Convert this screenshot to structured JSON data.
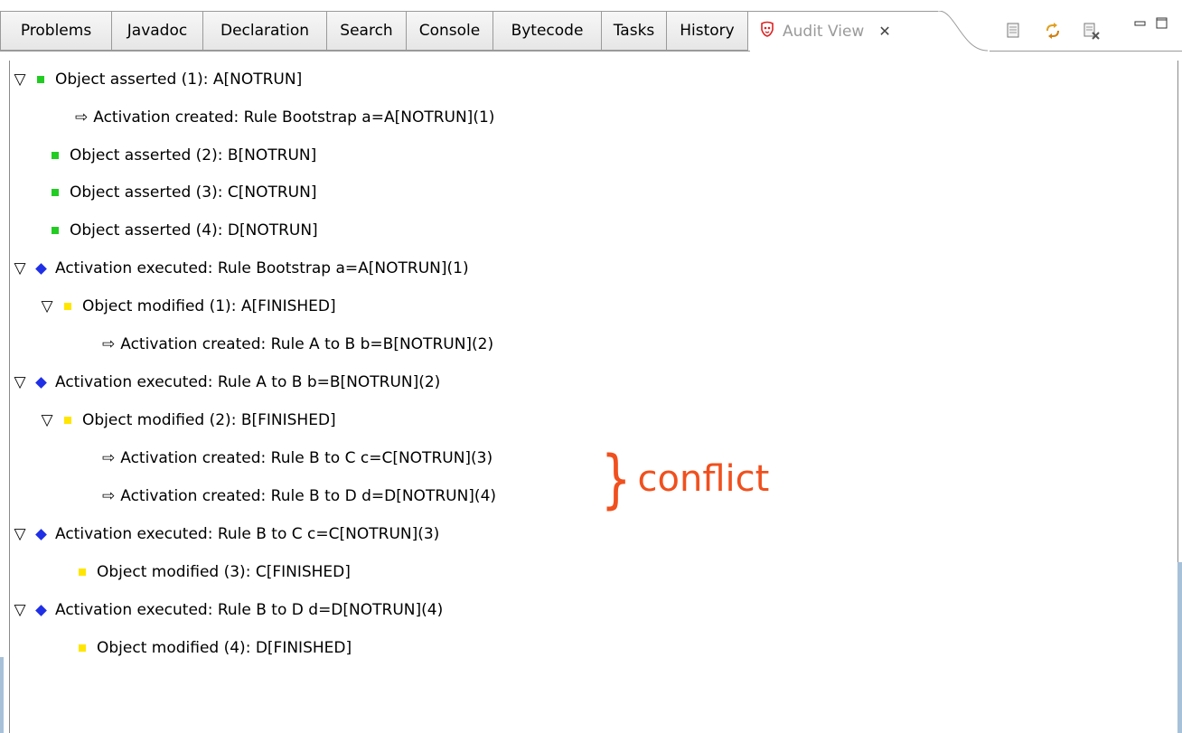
{
  "tabs": [
    {
      "label": "Problems"
    },
    {
      "label": "Javadoc"
    },
    {
      "label": "Declaration"
    },
    {
      "label": "Search"
    },
    {
      "label": "Console"
    },
    {
      "label": "Bytecode"
    },
    {
      "label": "Tasks"
    },
    {
      "label": "History"
    }
  ],
  "active_tab": {
    "label": "Audit View",
    "close_glyph": "✕",
    "icon": "audit-icon"
  },
  "toolbar": {
    "icons": [
      "open-log-icon",
      "refresh-icon",
      "clear-log-icon"
    ],
    "minimize_glyph": "▭",
    "maximize_glyph": "☐"
  },
  "tree": {
    "rows": [
      {
        "text": "Object asserted (1): A[NOTRUN]"
      },
      {
        "text": "Activation created: Rule Bootstrap a=A[NOTRUN](1)"
      },
      {
        "text": "Object asserted (2): B[NOTRUN]"
      },
      {
        "text": "Object asserted (3): C[NOTRUN]"
      },
      {
        "text": "Object asserted (4): D[NOTRUN]"
      },
      {
        "text": "Activation executed: Rule Bootstrap a=A[NOTRUN](1)"
      },
      {
        "text": "Object modified (1): A[FINISHED]"
      },
      {
        "text": "Activation created: Rule A to B b=B[NOTRUN](2)"
      },
      {
        "text": "Activation executed: Rule A to B b=B[NOTRUN](2)"
      },
      {
        "text": "Object modified (2): B[FINISHED]"
      },
      {
        "text": "Activation created: Rule B to C c=C[NOTRUN](3)"
      },
      {
        "text": "Activation created: Rule B to D d=D[NOTRUN](4)"
      },
      {
        "text": "Activation executed: Rule B to C c=C[NOTRUN](3)"
      },
      {
        "text": "Object modified (3): C[FINISHED]"
      },
      {
        "text": "Activation executed: Rule B to D d=D[NOTRUN](4)"
      },
      {
        "text": "Object modified (4): D[FINISHED]"
      }
    ],
    "expander_glyph": "▽",
    "arrow_glyph": "⇨"
  },
  "annotation": {
    "brace": "}",
    "text": "conflict",
    "color": "#f0501e"
  },
  "colors": {
    "asserted": "#22cc22",
    "modified": "#ffe600",
    "executed": "#1f2fe6"
  }
}
